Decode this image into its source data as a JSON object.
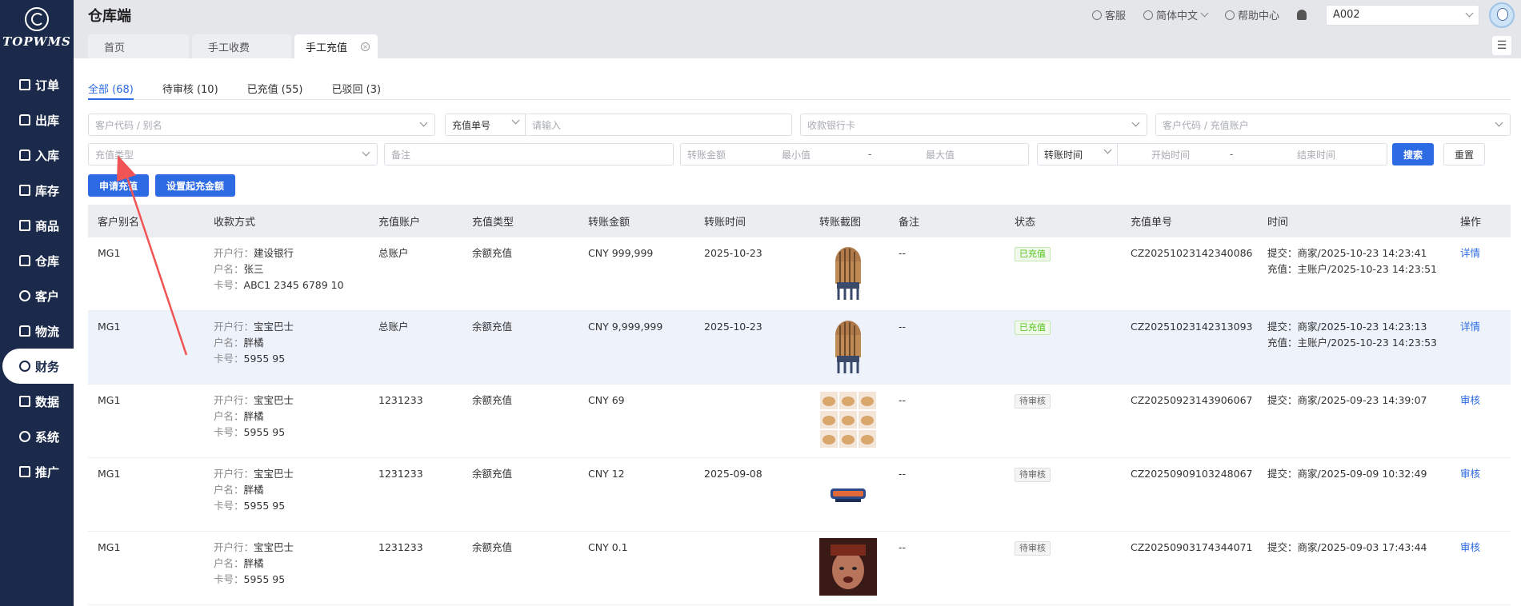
{
  "sidebar": {
    "logo": "TOPWMS",
    "items": [
      {
        "label": "订单",
        "icon": "order-icon"
      },
      {
        "label": "出库",
        "icon": "outbound-icon"
      },
      {
        "label": "入库",
        "icon": "inbound-icon"
      },
      {
        "label": "库存",
        "icon": "inventory-icon"
      },
      {
        "label": "商品",
        "icon": "goods-icon"
      },
      {
        "label": "仓库",
        "icon": "warehouse-icon"
      },
      {
        "label": "客户",
        "icon": "customer-icon"
      },
      {
        "label": "物流",
        "icon": "logistics-icon"
      },
      {
        "label": "财务",
        "icon": "finance-icon",
        "active": true
      },
      {
        "label": "数据",
        "icon": "data-icon"
      },
      {
        "label": "系统",
        "icon": "system-icon"
      },
      {
        "label": "推广",
        "icon": "promotion-icon"
      }
    ]
  },
  "header": {
    "title": "仓库端",
    "service": "客服",
    "language": "简体中文",
    "help": "帮助中心",
    "warehouse": "A002"
  },
  "page_tabs": [
    "首页",
    "手工收费",
    "手工充值"
  ],
  "status_tabs": [
    "全部 (68)",
    "待审核 (10)",
    "已充值 (55)",
    "已驳回 (3)"
  ],
  "filters": {
    "customer": "客户代码 / 别名",
    "order_type": "充值单号",
    "order_input": "请输入",
    "bank_card": "收款银行卡",
    "customer_account": "客户代码 / 充值账户",
    "recharge_type": "充值类型",
    "remark": "备注",
    "amount_label": "转账金额",
    "amount_min": "最小值",
    "amount_sep": "-",
    "amount_max": "最大值",
    "time_type": "转账时间",
    "time_start": "开始时间",
    "time_sep": "-",
    "time_end": "结束时间",
    "search": "搜索",
    "reset": "重置"
  },
  "actions": {
    "apply": "申请充值",
    "set_amount": "设置起充金额"
  },
  "table": {
    "headers": [
      "客户别名",
      "收款方式",
      "充值账户",
      "充值类型",
      "转账金额",
      "转账时间",
      "转账截图",
      "备注",
      "状态",
      "充值单号",
      "时间",
      "操作"
    ],
    "rows": [
      {
        "alias": "MG1",
        "bank": "建设银行",
        "holder": "张三",
        "card": "ABC1 2345 6789 10",
        "account": "总账户",
        "type": "余额充值",
        "amount": "CNY 999,999",
        "date": "2025-10-23",
        "remark": "--",
        "status": "已充值",
        "status_kind": "ok",
        "order_no": "CZ20251023142340086",
        "time1": "提交：商家/2025-10-23 14:23:41",
        "time2": "充值：主账户/2025-10-23 14:23:51",
        "op": "详情",
        "thumb": "chair"
      },
      {
        "alias": "MG1",
        "bank": "宝宝巴士",
        "holder": "胖橘",
        "card": "5955 95",
        "account": "总账户",
        "type": "余额充值",
        "amount": "CNY 9,999,999",
        "date": "2025-10-23",
        "remark": "--",
        "status": "已充值",
        "status_kind": "ok",
        "order_no": "CZ20251023142313093",
        "time1": "提交：商家/2025-10-23 14:23:13",
        "time2": "充值：主账户/2025-10-23 14:23:53",
        "op": "详情",
        "thumb": "chair",
        "highlight": true
      },
      {
        "alias": "MG1",
        "bank": "宝宝巴士",
        "holder": "胖橘",
        "card": "5955 95",
        "account": "1231233",
        "type": "余额充值",
        "amount": "CNY 69",
        "date": "",
        "remark": "--",
        "status": "待审核",
        "status_kind": "wait",
        "order_no": "CZ20250923143906067",
        "time1": "提交：商家/2025-09-23 14:39:07",
        "time2": "",
        "op": "审核",
        "thumb": "grid"
      },
      {
        "alias": "MG1",
        "bank": "宝宝巴士",
        "holder": "胖橘",
        "card": "5955 95",
        "account": "1231233",
        "type": "余额充值",
        "amount": "CNY 12",
        "date": "2025-09-08",
        "remark": "--",
        "status": "待审核",
        "status_kind": "wait",
        "order_no": "CZ20250909103248067",
        "time1": "提交：商家/2025-09-09 10:32:49",
        "time2": "",
        "op": "审核",
        "thumb": "badge"
      },
      {
        "alias": "MG1",
        "bank": "宝宝巴士",
        "holder": "胖橘",
        "card": "5955 95",
        "account": "1231233",
        "type": "余额充值",
        "amount": "CNY 0.1",
        "date": "",
        "remark": "--",
        "status": "待审核",
        "status_kind": "wait",
        "order_no": "CZ20250903174344071",
        "time1": "提交：商家/2025-09-03 17:43:44",
        "time2": "",
        "op": "审核",
        "thumb": "portrait"
      }
    ],
    "labels": {
      "bank": "开户行：",
      "holder": "户名：",
      "card": "卡号："
    }
  },
  "colors": {
    "sidebar": "#1b2a4a",
    "primary": "#2d6be4",
    "annotation_arrow": "#f05454"
  }
}
